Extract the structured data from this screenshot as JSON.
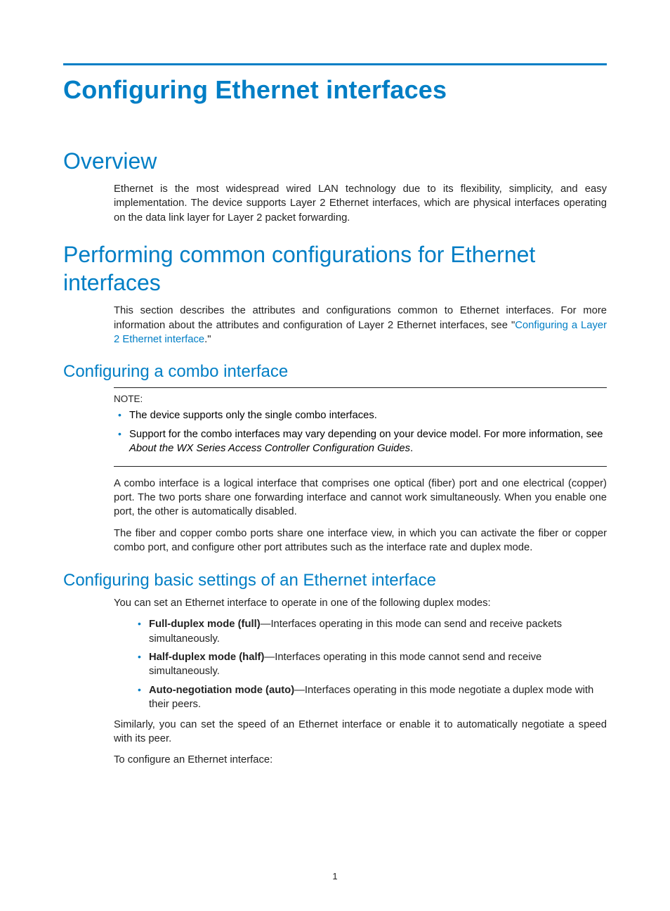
{
  "page": {
    "number": "1",
    "title": "Configuring Ethernet interfaces"
  },
  "sections": {
    "overview": {
      "heading": "Overview",
      "p1": "Ethernet is the most widespread wired LAN technology due to its flexibility, simplicity, and easy implementation. The device supports Layer 2 Ethernet interfaces, which are physical interfaces operating on the data link layer for Layer 2 packet forwarding."
    },
    "perform": {
      "heading": "Performing common configurations for Ethernet interfaces",
      "p1_pre": "This section describes the attributes and configurations common to Ethernet interfaces. For more information about the attributes and configuration of Layer 2 Ethernet interfaces, see \"",
      "link": "Configuring a Layer 2 Ethernet interface",
      "p1_post": ".\""
    },
    "combo": {
      "heading": "Configuring a combo interface",
      "note_label": "NOTE:",
      "note1": "The device supports only the single combo interfaces.",
      "note2_pre": "Support for the combo interfaces may vary depending on your device model. For more information, see ",
      "note2_italic": "About the WX Series Access Controller Configuration Guides",
      "note2_post": ".",
      "p1": "A combo interface is a logical interface that comprises one optical (fiber) port and one electrical (copper) port. The two ports share one forwarding interface and cannot work simultaneously. When you enable one port, the other is automatically disabled.",
      "p2": "The fiber and copper combo ports share one interface view, in which you can activate the fiber or copper combo port, and configure other port attributes such as the interface rate and duplex mode."
    },
    "basic": {
      "heading": "Configuring basic settings of an Ethernet interface",
      "intro": "You can set an Ethernet interface to operate in one of the following duplex modes:",
      "b1_label": "Full-duplex mode (full)",
      "b1_text": "—Interfaces operating in this mode can send and receive packets simultaneously.",
      "b2_label": "Half-duplex mode (half)",
      "b2_text": "—Interfaces operating in this mode cannot send and receive simultaneously.",
      "b3_label": "Auto-negotiation mode (auto)",
      "b3_text": "—Interfaces operating in this mode negotiate a duplex mode with their peers.",
      "p_after": "Similarly, you can set the speed of an Ethernet interface or enable it to automatically negotiate a speed with its peer.",
      "p_config": "To configure an Ethernet interface:"
    }
  }
}
